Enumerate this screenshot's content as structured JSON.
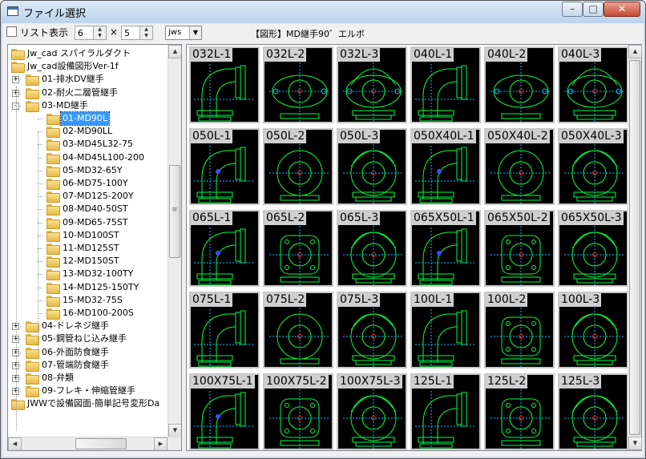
{
  "window": {
    "title": "ファイル選択"
  },
  "toolbar": {
    "list_label": "リスト表示",
    "cols": "6",
    "times": "×",
    "rows": "5",
    "ext": "jws",
    "caption": "【図形】MD継手90゜エルボ"
  },
  "tree": {
    "items": [
      {
        "label": "Jw_cad スパイラルダクト",
        "level": 0,
        "expander": ""
      },
      {
        "label": "Jw_cad設備図形Ver-1f",
        "level": 0,
        "expander": ""
      },
      {
        "label": "01-排水DV継手",
        "level": 1,
        "expander": "+"
      },
      {
        "label": "02-耐火二層管継手",
        "level": 1,
        "expander": "+"
      },
      {
        "label": "03-MD継手",
        "level": 1,
        "expander": "-"
      },
      {
        "label": "01-MD90L",
        "level": 2,
        "expander": "",
        "selected": true
      },
      {
        "label": "02-MD90LL",
        "level": 2,
        "expander": ""
      },
      {
        "label": "03-MD45L32-75",
        "level": 2,
        "expander": ""
      },
      {
        "label": "04-MD45L100-200",
        "level": 2,
        "expander": ""
      },
      {
        "label": "05-MD32-65Y",
        "level": 2,
        "expander": ""
      },
      {
        "label": "06-MD75-100Y",
        "level": 2,
        "expander": ""
      },
      {
        "label": "07-MD125-200Y",
        "level": 2,
        "expander": ""
      },
      {
        "label": "08-MD40-50ST",
        "level": 2,
        "expander": ""
      },
      {
        "label": "09-MD65-75ST",
        "level": 2,
        "expander": ""
      },
      {
        "label": "10-MD100ST",
        "level": 2,
        "expander": ""
      },
      {
        "label": "11-MD125ST",
        "level": 2,
        "expander": ""
      },
      {
        "label": "12-MD150ST",
        "level": 2,
        "expander": ""
      },
      {
        "label": "13-MD32-100TY",
        "level": 2,
        "expander": ""
      },
      {
        "label": "14-MD125-150TY",
        "level": 2,
        "expander": ""
      },
      {
        "label": "15-MD32-75S",
        "level": 2,
        "expander": ""
      },
      {
        "label": "16-MD100-200S",
        "level": 2,
        "expander": ""
      },
      {
        "label": "04-ドレネジ継手",
        "level": 1,
        "expander": "+"
      },
      {
        "label": "05-鋼管ねじ込み継手",
        "level": 1,
        "expander": "+"
      },
      {
        "label": "06-外面防食継手",
        "level": 1,
        "expander": "+"
      },
      {
        "label": "07-管端防食継手",
        "level": 1,
        "expander": "+"
      },
      {
        "label": "08-弁類",
        "level": 1,
        "expander": "+"
      },
      {
        "label": "09-フレキ・伸縮管継手",
        "level": 1,
        "expander": "+"
      },
      {
        "label": "JWWで設備図面-簡単記号変形Da",
        "level": 0,
        "expander": ""
      }
    ]
  },
  "grid": {
    "items": [
      {
        "label": "032L-1",
        "view": "side"
      },
      {
        "label": "032L-2",
        "view": "oval"
      },
      {
        "label": "032L-3",
        "view": "oval3"
      },
      {
        "label": "040L-1",
        "view": "side"
      },
      {
        "label": "040L-2",
        "view": "oval"
      },
      {
        "label": "040L-3",
        "view": "oval3"
      },
      {
        "label": "050L-1",
        "view": "sideflange"
      },
      {
        "label": "050L-2",
        "view": "round"
      },
      {
        "label": "050L-3",
        "view": "round3"
      },
      {
        "label": "050X40L-1",
        "view": "sideflange"
      },
      {
        "label": "050X40L-2",
        "view": "round"
      },
      {
        "label": "050X40L-3",
        "view": "round3"
      },
      {
        "label": "065L-1",
        "view": "sideflange"
      },
      {
        "label": "065L-2",
        "view": "square"
      },
      {
        "label": "065L-3",
        "view": "round3"
      },
      {
        "label": "065X50L-1",
        "view": "sideflange"
      },
      {
        "label": "065X50L-2",
        "view": "square"
      },
      {
        "label": "065X50L-3",
        "view": "round3"
      },
      {
        "label": "075L-1",
        "view": "side"
      },
      {
        "label": "075L-2",
        "view": "round"
      },
      {
        "label": "075L-3",
        "view": "round3"
      },
      {
        "label": "100L-1",
        "view": "side"
      },
      {
        "label": "100L-2",
        "view": "square"
      },
      {
        "label": "100L-3",
        "view": "round3"
      },
      {
        "label": "100X75L-1",
        "view": "sideflange"
      },
      {
        "label": "100X75L-2",
        "view": "square"
      },
      {
        "label": "100X75L-3",
        "view": "round3"
      },
      {
        "label": "125L-1",
        "view": "side"
      },
      {
        "label": "125L-2",
        "view": "square"
      },
      {
        "label": "125L-3",
        "view": "round3"
      }
    ]
  },
  "icons": {
    "minimize": "minimize-icon",
    "maximize": "maximize-icon",
    "close": "close-icon",
    "folder": "folder-icon",
    "spin_up": "▲",
    "spin_down": "▼",
    "scroll_up": "▲",
    "scroll_down": "▼",
    "scroll_left": "◀",
    "scroll_right": "▶",
    "dropdown": "▼",
    "grip": "≡"
  },
  "colors": {
    "drawing_bg": "#000000",
    "line": "#00ff40",
    "center": "#ff2020",
    "dash": "#00c0ff",
    "accent": "#3399ff"
  }
}
